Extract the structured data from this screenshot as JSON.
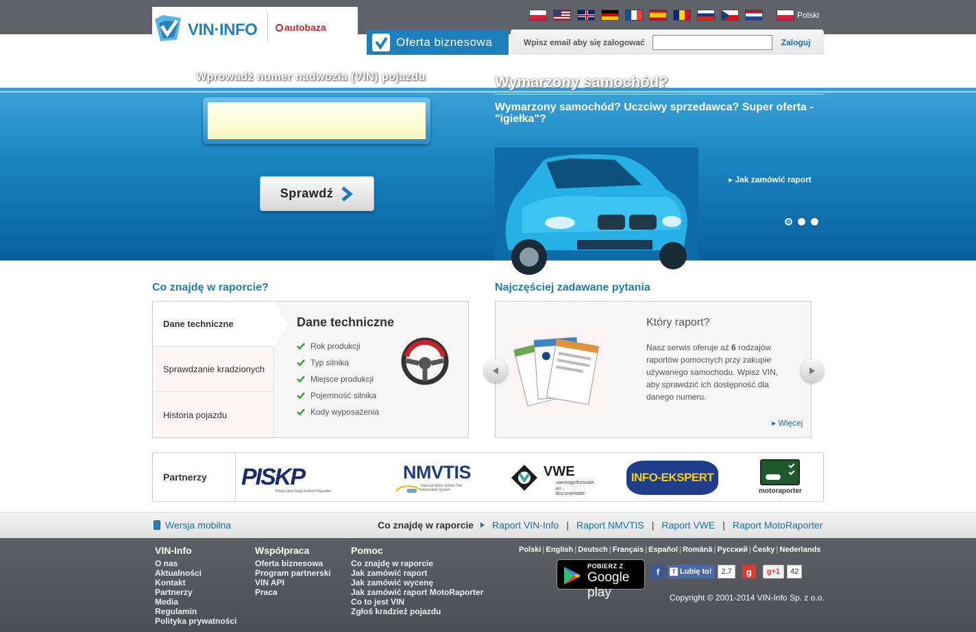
{
  "header": {
    "logo_text": "VIN·INFO",
    "autobaza_text": "autobaza",
    "business_tab": "Oferta biznesowa",
    "login": {
      "label": "Wpisz email aby się zalogować",
      "placeholder": "",
      "value": "",
      "button": "Zaloguj"
    },
    "current_language": "Polski",
    "flags": [
      "pl",
      "us",
      "gb",
      "de",
      "fr",
      "es",
      "ro",
      "ru",
      "cz",
      "nl"
    ]
  },
  "hero": {
    "left_title": "Wprowadź numer nadwozia (VIN) pojazdu",
    "vin_value": "",
    "check_button": "Sprawdź",
    "right_title": "Wymarzony samochód?",
    "slogan": "Wymarzony samochód? Uczciwy sprzedawca? Super oferta - \"igiełka\"?",
    "how_to_order": "Jak zamówić raport"
  },
  "report_section": {
    "title": "Co znajdę w raporcie?",
    "tabs": [
      "Dane techniczne",
      "Sprawdzanie kradzionych",
      "Historia pojazdu"
    ],
    "content_title": "Dane techniczne",
    "items": [
      "Rok produkcji",
      "Typ silnika",
      "Miejsce produkcji",
      "Pojemność silnika",
      "Kody wyposażenia"
    ]
  },
  "faq_section": {
    "title": "Najczęściej zadawane pytania",
    "question": "Który raport?",
    "answer_pre": "Nasz serwis oferuje aż ",
    "answer_num": "6",
    "answer_post": " rodzajów raportów pomocnych przy zakupie używanego samochodu. Wpisz VIN, aby sprawdzić ich dostępność dla danego numeru.",
    "more": "Więcej"
  },
  "partners": {
    "label": "Partnerzy",
    "logos": [
      "PISKP",
      "NMVTIS",
      "VWE",
      "INFO-EKSPERT",
      "motoraporter"
    ],
    "piskp_sub": "Polska Izba Stacji Kontroli Pojazdów",
    "nmvtis_sub": "National Motor Vehicle Title Information System",
    "vwe_sub1": "voertuiginformatie",
    "vwe_sub2": "en -documentatie"
  },
  "links_band": {
    "mobile": "Wersja mobilna",
    "reports_title": "Co znajdę w raporcie",
    "reports": [
      "Raport VIN-Info",
      "Raport NMVTIS",
      "Raport VWE",
      "Raport MotoRaporter"
    ]
  },
  "footer": {
    "col1": {
      "title": "VIN-Info",
      "links": [
        "O nas",
        "Aktualności",
        "Kontakt",
        "Partnerzy",
        "Media",
        "Regulamin",
        "Polityka prywatności"
      ]
    },
    "col2": {
      "title": "Współpraca",
      "links": [
        "Oferta biznesowa",
        "Program partnerski",
        "VIN API",
        "Praca"
      ]
    },
    "col3": {
      "title": "Pomoc",
      "links": [
        "Co znajdę w raporcie",
        "Jak zamówić raport",
        "Jak zamówić wycenę",
        "Jak zamówić raport MotoRaporter",
        "Co to jest VIN",
        "Zgłoś kradzież pojazdu"
      ]
    },
    "languages": [
      "Polski",
      "English",
      "Deutsch",
      "Français",
      "Español",
      "Română",
      "Русский",
      "Česky",
      "Nederlands"
    ],
    "google_play_small": "POBIERZ Z",
    "google_play_big": "Google play",
    "fb_like": "Lubię to!",
    "fb_count": "2,7",
    "gplus_label": "+1",
    "gplus_count": "42",
    "copyright": "Copyright © 2001-2014 VIN-Info Sp. z o.o."
  }
}
